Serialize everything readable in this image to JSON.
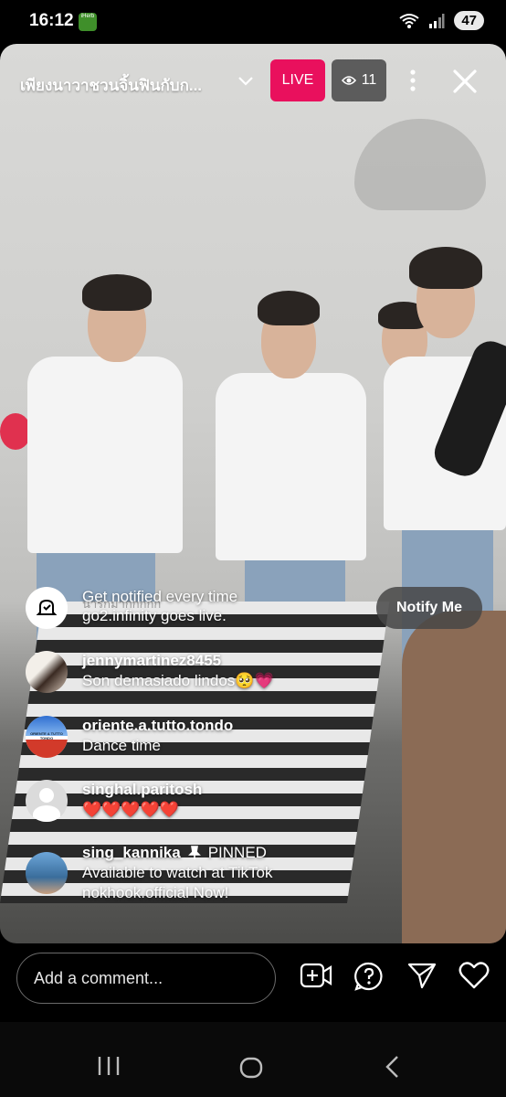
{
  "status": {
    "time": "16:12",
    "iherb": "iHerb",
    "battery": "47"
  },
  "live": {
    "title": "เพียงนาวาชวนจิ้นฟินกับก...",
    "live_label": "LIVE",
    "viewers": "11",
    "faint_comment": "น่ารักมากกกกก"
  },
  "notify": {
    "text_line1": "Get notified every time",
    "text_line2": "go2.infinity goes live.",
    "button": "Notify Me"
  },
  "comments": [
    {
      "user": "jennymartinez8455",
      "text": "Son demasiado lindos🥺💗"
    },
    {
      "user": "oriente.a.tutto.tondo",
      "text": "Dance time",
      "avatar_text": "ORIENTE A TUTTO TONDO"
    },
    {
      "user": "singhal.paritosh",
      "text": "❤️❤️❤️❤️❤️"
    },
    {
      "user": "sing_kannika",
      "pinned": "PINNED",
      "text_line1": "Available to watch at TikTok",
      "text_line2": "nokhook.official Now!"
    }
  ],
  "bottom": {
    "placeholder": "Add a comment..."
  },
  "colors": {
    "live": "#e9105d",
    "pill": "#464646"
  }
}
